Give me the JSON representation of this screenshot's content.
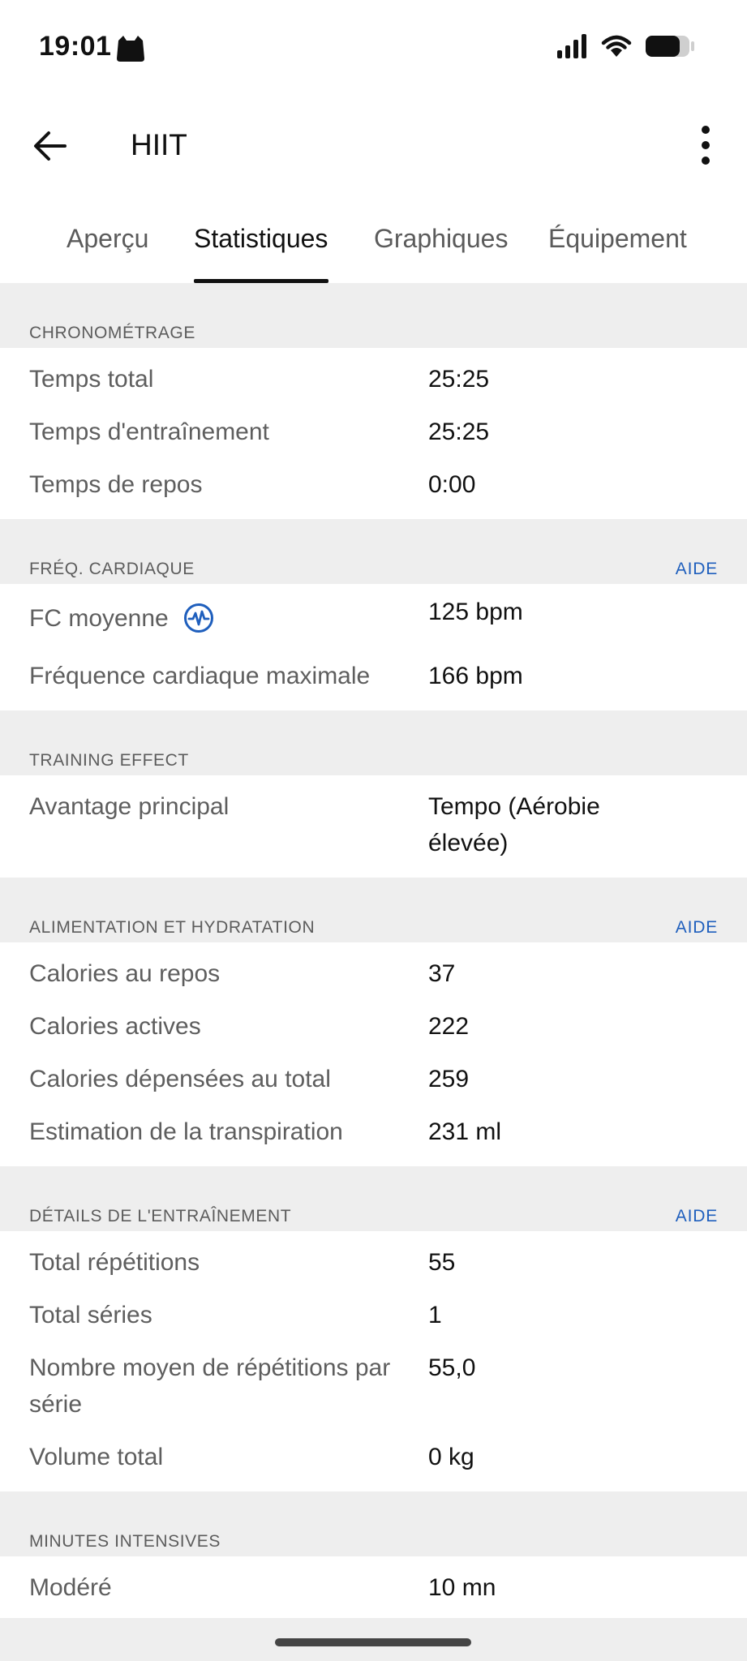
{
  "status_bar": {
    "time": "19:01"
  },
  "app_bar": {
    "title": "HIIT"
  },
  "tabs": [
    {
      "label": "Aperçu"
    },
    {
      "label": "Statistiques",
      "active": true
    },
    {
      "label": "Graphiques"
    },
    {
      "label": "Équipement"
    }
  ],
  "sections": {
    "chrono": {
      "title": "CHRONOMÉTRAGE",
      "rows": [
        {
          "label": "Temps total",
          "value": "25:25"
        },
        {
          "label": "Temps d'entraînement",
          "value": "25:25"
        },
        {
          "label": "Temps de repos",
          "value": "0:00"
        }
      ]
    },
    "hr": {
      "title": "FRÉQ. CARDIAQUE",
      "help": "AIDE",
      "rows": [
        {
          "label": "FC moyenne",
          "value": "125 bpm"
        },
        {
          "label": "Fréquence cardiaque maximale",
          "value": "166 bpm"
        }
      ]
    },
    "te": {
      "title": "TRAINING EFFECT",
      "rows": [
        {
          "label": "Avantage principal",
          "value": "Tempo (Aérobie élevée)"
        }
      ]
    },
    "food": {
      "title": "ALIMENTATION ET HYDRATATION",
      "help": "AIDE",
      "rows": [
        {
          "label": "Calories au repos",
          "value": "37"
        },
        {
          "label": "Calories actives",
          "value": "222"
        },
        {
          "label": "Calories dépensées au total",
          "value": "259"
        },
        {
          "label": "Estimation de la transpiration",
          "value": "231 ml"
        }
      ]
    },
    "training": {
      "title": "DÉTAILS DE L'ENTRAÎNEMENT",
      "help": "AIDE",
      "rows": [
        {
          "label": "Total répétitions",
          "value": "55"
        },
        {
          "label": "Total séries",
          "value": "1"
        },
        {
          "label": "Nombre moyen de répétitions par série",
          "value": "55,0"
        },
        {
          "label": "Volume total",
          "value": "0 kg"
        }
      ]
    },
    "intensity": {
      "title": "MINUTES INTENSIVES",
      "rows": [
        {
          "label": "Modéré",
          "value": "10 mn"
        }
      ]
    }
  },
  "colors": {
    "accent": "#1f5fbd",
    "section_bg": "#eeeeee"
  }
}
